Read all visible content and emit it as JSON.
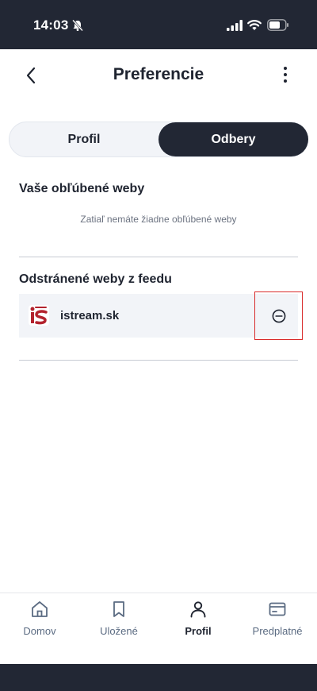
{
  "status_bar": {
    "time": "14:03"
  },
  "header": {
    "title": "Preferencie"
  },
  "tabs": [
    {
      "label": "Profil",
      "active": false
    },
    {
      "label": "Odbery",
      "active": true
    }
  ],
  "favorites": {
    "title": "Vaše obľúbené weby",
    "empty_text": "Zatiaľ nemáte žiadne obľúbené weby"
  },
  "removed": {
    "title": "Odstránené weby z feedu",
    "items": [
      {
        "name": "istream.sk",
        "logo": "istream-logo"
      }
    ]
  },
  "bottom_nav": [
    {
      "label": "Domov",
      "icon": "home-icon"
    },
    {
      "label": "Uložené",
      "icon": "bookmark-icon"
    },
    {
      "label": "Profil",
      "icon": "user-icon",
      "active": true
    },
    {
      "label": "Predplatné",
      "icon": "card-icon"
    }
  ],
  "colors": {
    "dark": "#222734",
    "highlight": "#d92b2b",
    "row_bg": "#f2f4f8"
  }
}
